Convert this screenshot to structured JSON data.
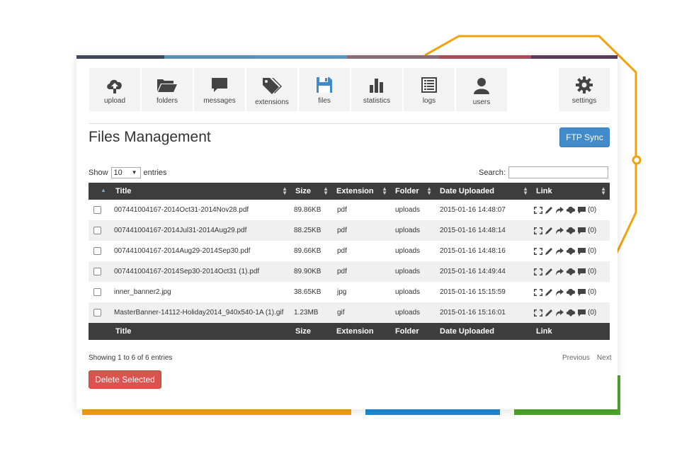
{
  "toolbar": {
    "items": [
      {
        "label": "upload",
        "icon": "cloud-upload-icon"
      },
      {
        "label": "folders",
        "icon": "folder-open-icon"
      },
      {
        "label": "messages",
        "icon": "message-icon"
      },
      {
        "label": "extensions",
        "icon": "tags-icon"
      },
      {
        "label": "files",
        "icon": "floppy-disk-icon"
      },
      {
        "label": "statistics",
        "icon": "bar-chart-icon"
      },
      {
        "label": "logs",
        "icon": "list-icon"
      },
      {
        "label": "users",
        "icon": "user-icon"
      },
      {
        "label": "settings",
        "icon": "gear-icon"
      }
    ],
    "active": "files"
  },
  "page": {
    "title": "Files Management",
    "ftp_button": "FTP Sync"
  },
  "controls": {
    "show_label": "Show",
    "show_value": "10",
    "entries_label": "entries",
    "search_label": "Search:",
    "search_value": ""
  },
  "table": {
    "columns": [
      "Title",
      "Size",
      "Extension",
      "Folder",
      "Date Uploaded",
      "Link"
    ],
    "rows": [
      {
        "title": "007441004167-2014Oct31-2014Nov28.pdf",
        "size": "89.86KB",
        "ext": "pdf",
        "folder": "uploads",
        "date": "2015-01-16 14:48:07",
        "comments": "(0)"
      },
      {
        "title": "007441004167-2014Jul31-2014Aug29.pdf",
        "size": "88.25KB",
        "ext": "pdf",
        "folder": "uploads",
        "date": "2015-01-16 14:48:14",
        "comments": "(0)"
      },
      {
        "title": "007441004167-2014Aug29-2014Sep30.pdf",
        "size": "89.66KB",
        "ext": "pdf",
        "folder": "uploads",
        "date": "2015-01-16 14:48:16",
        "comments": "(0)"
      },
      {
        "title": "007441004167-2014Sep30-2014Oct31 (1).pdf",
        "size": "89.90KB",
        "ext": "pdf",
        "folder": "uploads",
        "date": "2015-01-16 14:49:44",
        "comments": "(0)"
      },
      {
        "title": "inner_banner2.jpg",
        "size": "38.65KB",
        "ext": "jpg",
        "folder": "uploads",
        "date": "2015-01-16 15:15:59",
        "comments": "(0)"
      },
      {
        "title": "MasterBanner-14112-Holiday2014_940x540-1A (1).gif",
        "size": "1.23MB",
        "ext": "gif",
        "folder": "uploads",
        "date": "2015-01-16 15:16:01",
        "comments": "(0)"
      }
    ]
  },
  "footer": {
    "info": "Showing 1 to 6 of 6 entries",
    "previous": "Previous",
    "next": "Next",
    "delete_button": "Delete Selected"
  },
  "colors": {
    "accent_blue": "#428bca",
    "danger_red": "#d9534f",
    "table_header": "#3d3d3d",
    "deco_orange": "#f2a20a",
    "deco_blue": "#1b8bd2",
    "deco_green": "#4fa52c"
  }
}
